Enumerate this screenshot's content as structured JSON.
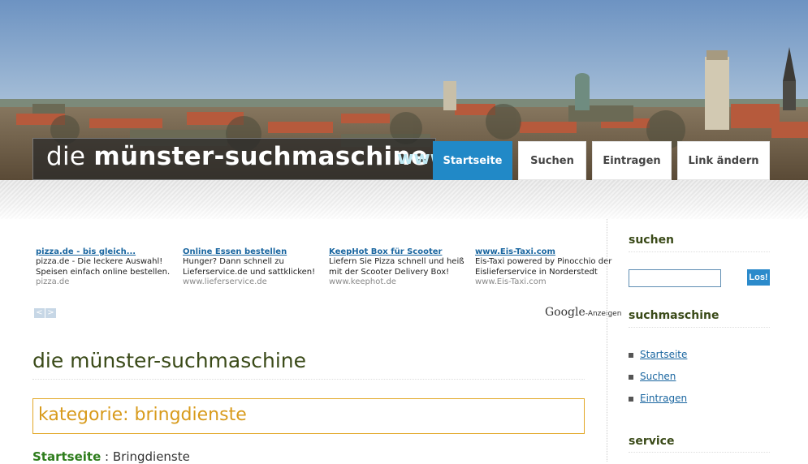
{
  "header": {
    "site_title_prefix": "die ",
    "site_title_main": "münster-suchmaschine",
    "site_url": "www"
  },
  "nav": {
    "items": [
      {
        "label": "Startseite",
        "active": true
      },
      {
        "label": "Suchen",
        "active": false
      },
      {
        "label": "Eintragen",
        "active": false
      },
      {
        "label": "Link ändern",
        "active": false
      }
    ]
  },
  "ads": {
    "items": [
      {
        "title": "pizza.de - bis gleich...",
        "text": "pizza.de - Die leckere Auswahl! Speisen einfach online bestellen.",
        "url": "pizza.de"
      },
      {
        "title": "Online Essen bestellen",
        "text": "Hunger? Dann schnell zu Lieferservice.de und sattklicken!",
        "url": "www.lieferservice.de"
      },
      {
        "title": "KeepHot Box für Scooter",
        "text": "Liefern Sie Pizza schnell und heiß mit der Scooter Delivery Box!",
        "url": "www.keephot.de"
      },
      {
        "title": "www.Eis-Taxi.com",
        "text": "Eis-Taxi powered by Pinocchio der Eislieferservice in Norderstedt",
        "url": "www.Eis-Taxi.com"
      }
    ],
    "prev_arrow": "<",
    "next_arrow": ">",
    "google_label": "Google",
    "anzeigen_label": "-Anzeigen"
  },
  "main": {
    "title": "die münster-suchmaschine",
    "category_label": "kategorie: bringdienste",
    "breadcrumb_link": "Startseite",
    "breadcrumb_sep": " : ",
    "breadcrumb_current": "Bringdienste"
  },
  "sidebar": {
    "search_heading": "suchen",
    "search_placeholder": "",
    "search_button": "Los!",
    "nav_heading": "suchmaschine",
    "nav_links": [
      "Startseite",
      "Suchen",
      "Eintragen"
    ],
    "service_heading": "service"
  },
  "colors": {
    "accent_blue": "#2189c7",
    "title_green": "#3a4a18",
    "category_orange": "#d89b1c",
    "link_blue": "#1a66a0"
  }
}
